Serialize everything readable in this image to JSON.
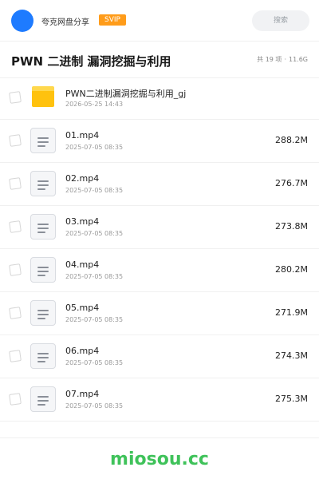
{
  "header": {
    "user_name": "夸克网盘分享",
    "badge": "SVIP",
    "search_placeholder": "搜索"
  },
  "title_bar": {
    "title": "PWN 二进制 漏洞挖掘与利用",
    "item_count": "共 19 项",
    "separator": "·",
    "total_size": "11.6G"
  },
  "colors": {
    "accent_blue": "#1e7bff",
    "badge_orange": "#ff9c1a",
    "folder_yellow": "#ffc20e",
    "watermark_green": "#3fc25a"
  },
  "files": [
    {
      "name": "PWN二进制漏洞挖掘与利用_gj",
      "date": "2026-05-25 14:43",
      "size": "",
      "icon": "folder-icon"
    },
    {
      "name": "01.mp4",
      "date": "2025-07-05 08:35",
      "size": "288.2M",
      "icon": "video-file-icon"
    },
    {
      "name": "02.mp4",
      "date": "2025-07-05 08:35",
      "size": "276.7M",
      "icon": "video-file-icon"
    },
    {
      "name": "03.mp4",
      "date": "2025-07-05 08:35",
      "size": "273.8M",
      "icon": "video-file-icon"
    },
    {
      "name": "04.mp4",
      "date": "2025-07-05 08:35",
      "size": "280.2M",
      "icon": "video-file-icon"
    },
    {
      "name": "05.mp4",
      "date": "2025-07-05 08:35",
      "size": "271.9M",
      "icon": "video-file-icon"
    },
    {
      "name": "06.mp4",
      "date": "2025-07-05 08:35",
      "size": "274.3M",
      "icon": "video-file-icon"
    },
    {
      "name": "07.mp4",
      "date": "2025-07-05 08:35",
      "size": "275.3M",
      "icon": "video-file-icon"
    }
  ],
  "footer": {
    "watermark": "miosou.cc"
  }
}
